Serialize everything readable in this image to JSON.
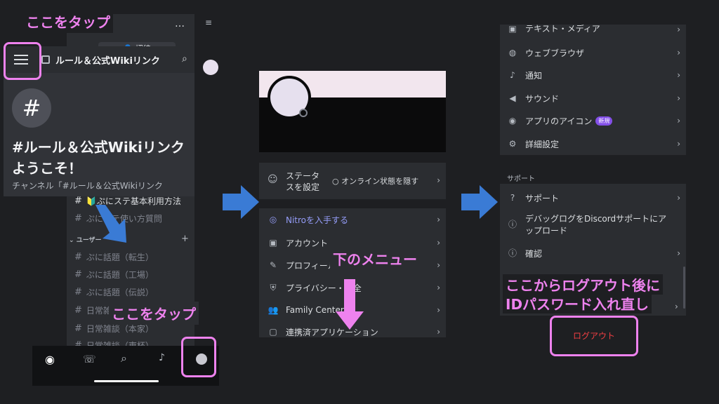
{
  "annotations": {
    "tap_top": "ここをタップ",
    "tap_bottom": "ここをタップ",
    "lower_menu": "下のメニュー",
    "logout_note_1": "ここからログアウト後に",
    "logout_note_2": "IDパスワード入れ直し"
  },
  "panel1": {
    "invite": "招待",
    "channel_header": "ルール＆公式Wikiリンク",
    "welcome_title_1": "#ルール＆公式Wikiリンク",
    "welcome_title_2": "ようこそ！",
    "welcome_sub": "チャンネル「#ルール＆公式Wikiリンク",
    "dots": "…",
    "channels": [
      "🔰ぷにステ基本利用方法",
      "ぷにステ使い方質問"
    ],
    "category": "ユーザー",
    "user_channels": [
      "ぷに話題（転生）",
      "ぷに話題（工場）",
      "ぷに話題（伝説）",
      "日常雑談（北海",
      "日常雑談（本家）",
      "日常雑談（東杯）"
    ]
  },
  "panel2": {
    "status_label_1": "ステータ",
    "status_label_2": "スを設定",
    "status_value": "オンライン状態を隠す",
    "menu": [
      {
        "label": "Nitroを入手する",
        "icon": "nitro-icon"
      },
      {
        "label": "アカウント",
        "icon": "account-icon"
      },
      {
        "label": "プロフィール",
        "icon": "pencil-icon"
      },
      {
        "label": "プライバシー・安全",
        "icon": "shield-icon"
      },
      {
        "label": "Family Center",
        "icon": "family-icon"
      },
      {
        "label": "連携済アプリケーション",
        "icon": "apps-icon"
      }
    ]
  },
  "panel3": {
    "top_cut": "テキスト・メディア",
    "items": [
      {
        "label": "ウェブブラウザ",
        "icon": "globe-icon"
      },
      {
        "label": "通知",
        "icon": "bell-icon"
      },
      {
        "label": "サウンド",
        "icon": "speaker-icon"
      },
      {
        "label": "アプリのアイコン",
        "icon": "discord-icon",
        "badge": "新規"
      },
      {
        "label": "詳細設定",
        "icon": "gear-icon"
      }
    ],
    "section": "サポート",
    "support_items": [
      {
        "label": "サポート",
        "icon": "help-icon"
      },
      {
        "label": "デバッグログをDiscordサポートにアップロード",
        "icon": "info-icon"
      },
      {
        "label": "確認",
        "icon": "info-icon"
      }
    ],
    "logout": "ログアウト"
  },
  "colors": {
    "pink": "#ee82ee",
    "arrow": "#3a7bd5",
    "nitro": "#949cf7",
    "logout": "#f23f43"
  }
}
